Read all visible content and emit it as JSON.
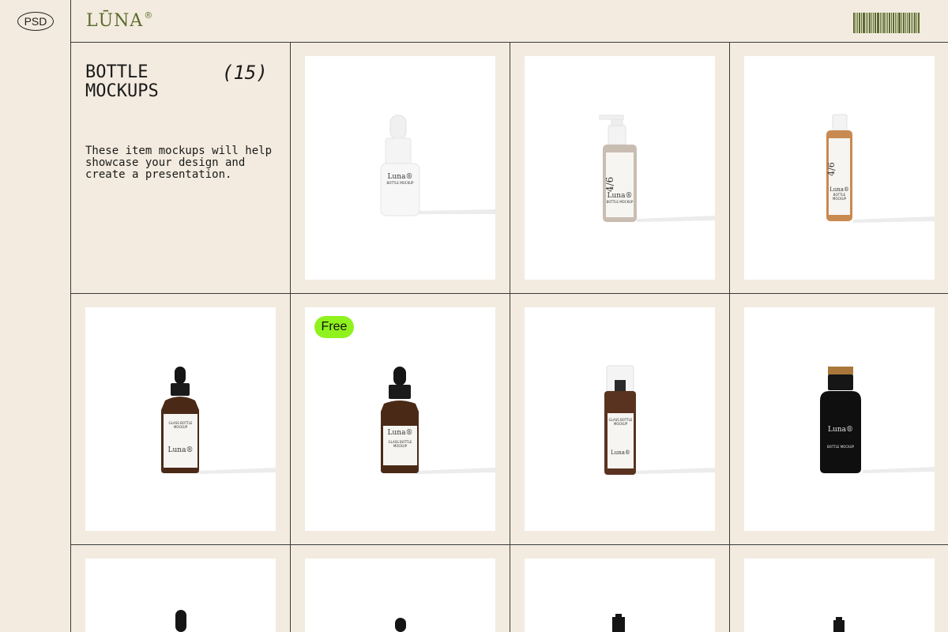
{
  "header": {
    "format_badge": "PSD",
    "logo": "LŪNA",
    "logo_mark": "®"
  },
  "intro": {
    "title": "BOTTLE MOCKUPS",
    "count": "(15)",
    "description": "These item mockups will help showcase your design and create a presentation."
  },
  "badges": {
    "free": "Free"
  },
  "bottles": [
    {
      "name": "white-dropper-bottle",
      "brand": "Luna®",
      "text": "BOTTLE MOCKUP"
    },
    {
      "name": "beige-pump-bottle",
      "brand": "Luna®",
      "text": "BOTTLE MOCKUP"
    },
    {
      "name": "amber-pump-bottle",
      "brand": "Luna®",
      "text": "BOTTLE MOCKUP"
    },
    {
      "name": "glass-dropper-bottle-large",
      "brand": "Luna®",
      "text": "GLASS BOTTLE MOCKUP"
    },
    {
      "name": "glass-dropper-bottle-small",
      "brand": "Luna®",
      "text": "GLASS BOTTLE MOCKUP"
    },
    {
      "name": "amber-foam-bottle",
      "brand": "Luna®",
      "text": "GLASS BOTTLE MOCKUP"
    },
    {
      "name": "black-pump-bottle",
      "brand": "Luna®",
      "text": "BOTTLE MOCKUP"
    }
  ],
  "colors": {
    "background": "#f3ebdf",
    "accent": "#5a6b2c",
    "free_badge": "#8ff21f"
  }
}
